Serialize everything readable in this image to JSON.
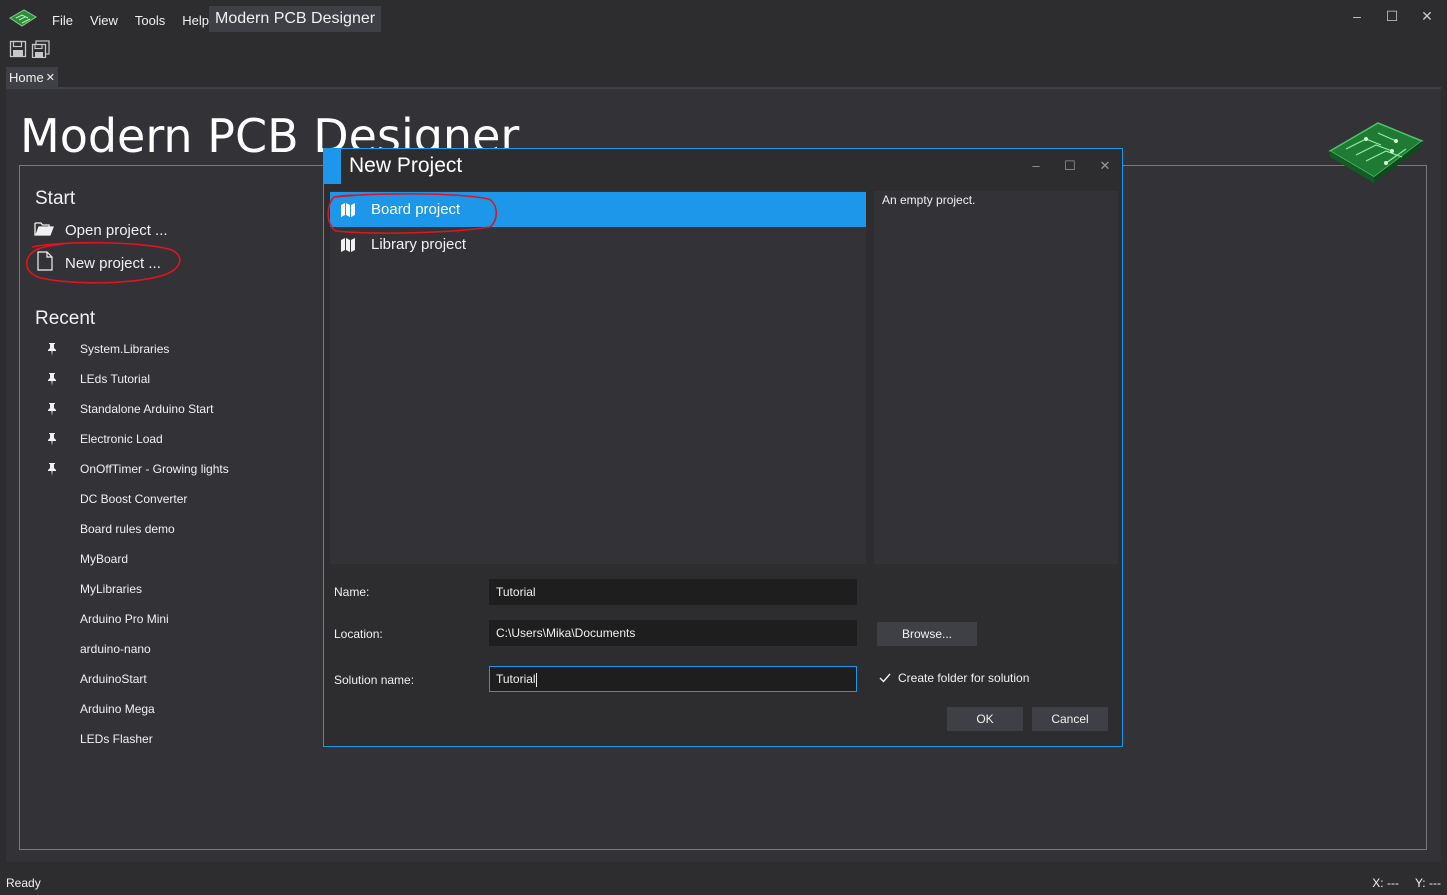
{
  "window": {
    "title": "Modern PCB Designer",
    "menu": [
      "File",
      "View",
      "Tools",
      "Help"
    ],
    "controls": {
      "minimize": "–",
      "maximize": "☐",
      "close": "✕"
    }
  },
  "toolbar": {
    "icons": [
      "save-icon",
      "save-all-icon"
    ]
  },
  "tabs": [
    {
      "label": "Home",
      "close": "✕"
    }
  ],
  "home": {
    "title": "Modern PCB Designer",
    "start": {
      "heading": "Start",
      "open_project": "Open project ...",
      "new_project": "New project ..."
    },
    "recent": {
      "heading": "Recent",
      "items": [
        {
          "label": "System.Libraries",
          "pinned": true
        },
        {
          "label": "LEds Tutorial",
          "pinned": true
        },
        {
          "label": "Standalone Arduino Start",
          "pinned": true
        },
        {
          "label": "Electronic Load",
          "pinned": true
        },
        {
          "label": "OnOffTimer - Growing lights",
          "pinned": true
        },
        {
          "label": "DC Boost Converter",
          "pinned": false
        },
        {
          "label": "Board rules demo",
          "pinned": false
        },
        {
          "label": "MyBoard",
          "pinned": false
        },
        {
          "label": "MyLibraries",
          "pinned": false
        },
        {
          "label": "Arduino Pro Mini",
          "pinned": false
        },
        {
          "label": "arduino-nano",
          "pinned": false
        },
        {
          "label": "ArduinoStart",
          "pinned": false
        },
        {
          "label": "Arduino Mega",
          "pinned": false
        },
        {
          "label": "LEDs Flasher",
          "pinned": false
        }
      ]
    }
  },
  "dialog": {
    "title": "New Project",
    "controls": {
      "minimize": "–",
      "maximize": "☐",
      "close": "✕"
    },
    "templates": [
      {
        "label": "Board project",
        "selected": true
      },
      {
        "label": "Library project",
        "selected": false
      }
    ],
    "description": "An empty project.",
    "fields": {
      "name_label": "Name:",
      "name_value": "Tutorial",
      "location_label": "Location:",
      "location_value": "C:\\Users\\Mika\\Documents",
      "solution_label": "Solution name:",
      "solution_value": "Tutorial"
    },
    "browse_label": "Browse...",
    "create_folder_label": "Create folder for solution",
    "create_folder_checked": true,
    "ok_label": "OK",
    "cancel_label": "Cancel"
  },
  "status": {
    "text": "Ready",
    "x_label": "X:",
    "x_value": "---",
    "y_label": "Y:",
    "y_value": "---"
  },
  "colors": {
    "accent": "#1c97ea",
    "background": "#2d2d30",
    "panel": "#333337",
    "annotation": "#e0141e"
  }
}
